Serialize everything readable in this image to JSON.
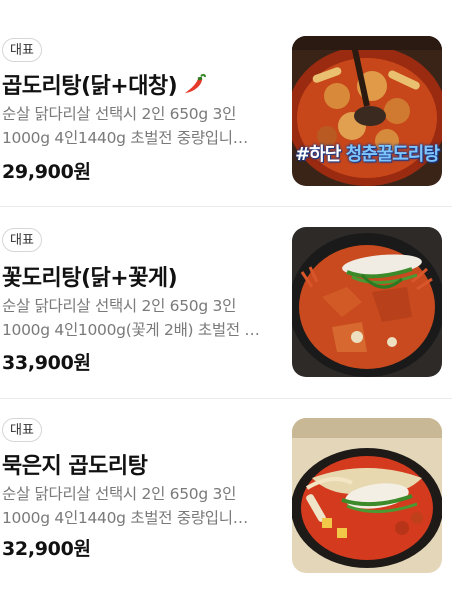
{
  "items": [
    {
      "badge": "대표",
      "name": "곱도리탕(닭+대창)",
      "desc_line1": "순살 닭다리살 선택시 2인 650g 3인",
      "desc_line2": "1000g 4인1440g 초벌전 중량입니…",
      "price": "29,900원",
      "image_caption_a": "#하단",
      "image_caption_b": "청춘꿀도리탕"
    },
    {
      "badge": "대표",
      "name": "꽃도리탕(닭+꽃게)",
      "desc_line1": "순살 닭다리살 선택시 2인 650g 3인",
      "desc_line2": "1000g 4인1000g(꽃게 2배) 초벌전 …",
      "price": "33,900원"
    },
    {
      "badge": "대표",
      "name": "묵은지 곱도리탕",
      "desc_line1": "순살 닭다리살 선택시 2인 650g 3인",
      "desc_line2": "1000g 4인1440g 초벌전 중량입니…",
      "price": "32,900원"
    }
  ],
  "colors": {
    "chili": "#e53a2a",
    "desc": "#7a7a7a",
    "divider": "#ececec"
  }
}
